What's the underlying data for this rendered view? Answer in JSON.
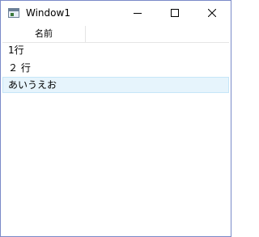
{
  "window": {
    "title": "Window1",
    "icons": {
      "app": "app-window-icon",
      "minimize": "minimize-icon",
      "maximize": "maximize-icon",
      "close": "close-icon"
    }
  },
  "listview": {
    "columns": [
      "名前"
    ],
    "rows": [
      {
        "name": "1行",
        "selected": false
      },
      {
        "name": "２ 行",
        "selected": false
      },
      {
        "name": "あいうえお",
        "selected": true
      }
    ],
    "selection_color": "#e6f4fc",
    "selection_border": "#c6e6f8"
  }
}
